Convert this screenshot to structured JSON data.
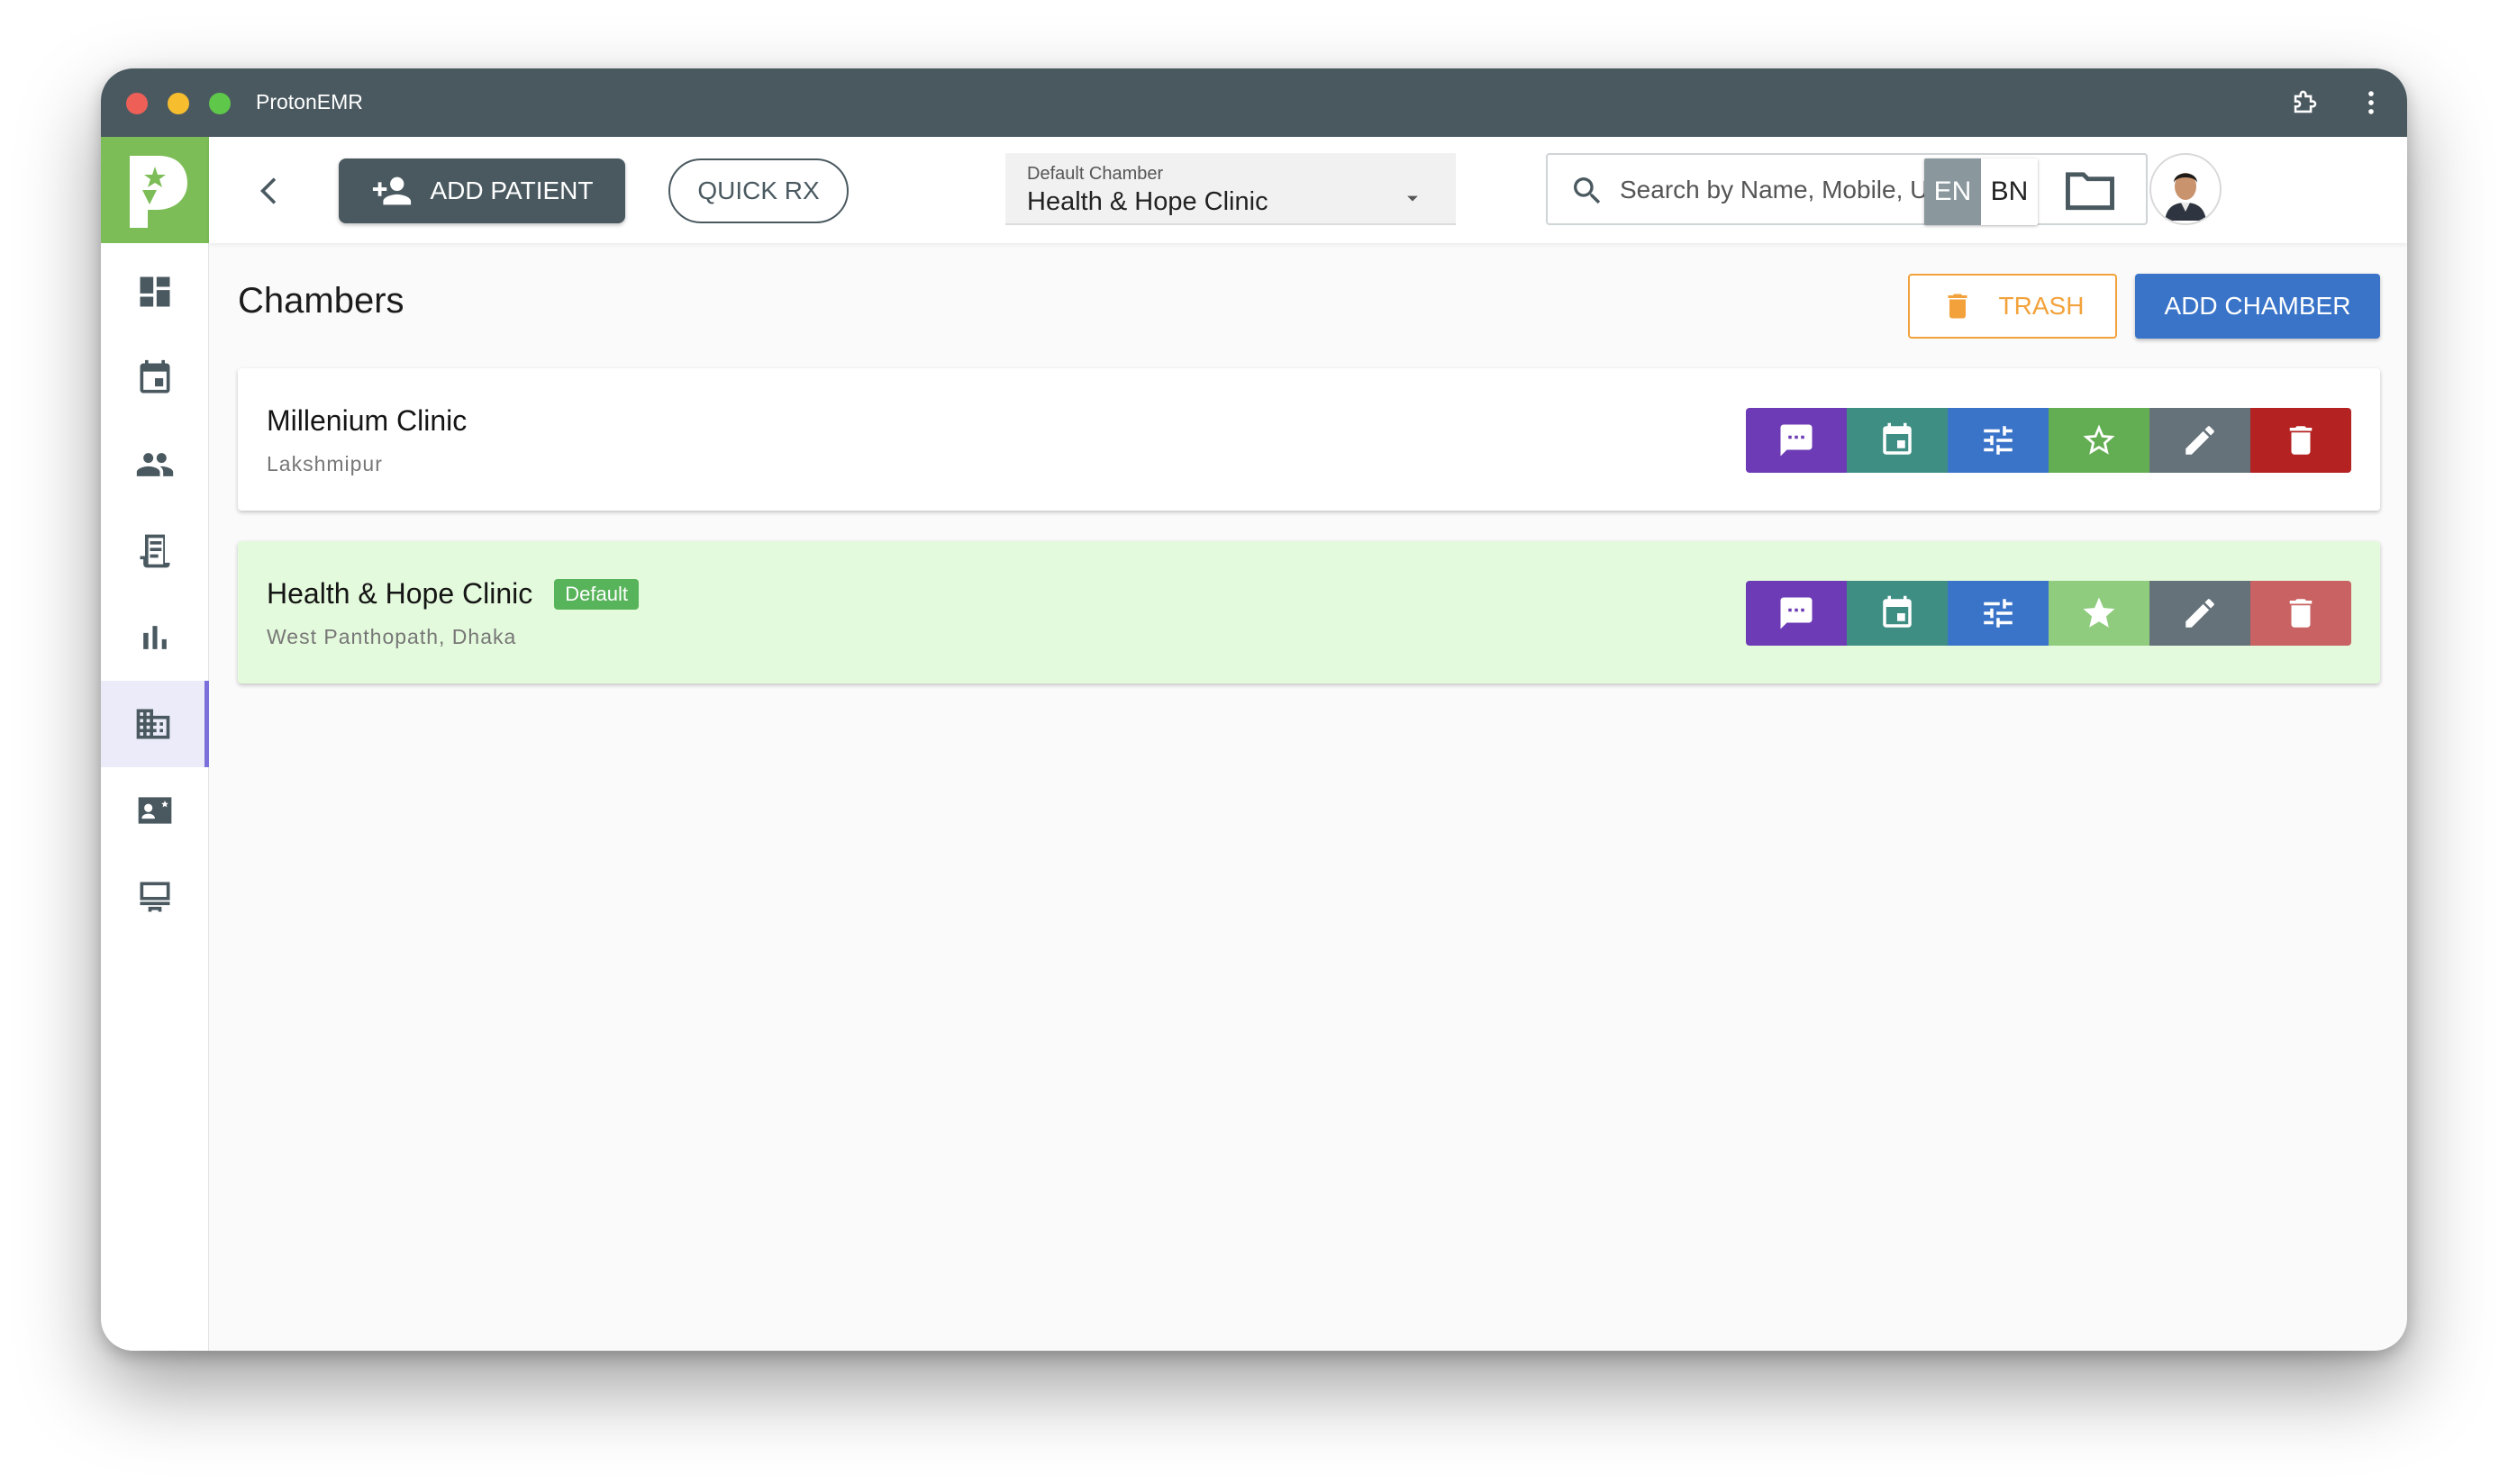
{
  "window": {
    "title": "ProtonEMR"
  },
  "header": {
    "add_patient_label": "ADD PATIENT",
    "quick_rx_label": "QUICK RX",
    "chamber_select": {
      "label": "Default Chamber",
      "value": "Health & Hope Clinic"
    },
    "search": {
      "placeholder": "Search by Name, Mobile, UUID..."
    },
    "lang": {
      "en": "EN",
      "bn": "BN",
      "active": "EN"
    }
  },
  "sidebar": {
    "items": [
      {
        "name": "dashboard",
        "icon": "dashboard-icon"
      },
      {
        "name": "appointments",
        "icon": "calendar-icon"
      },
      {
        "name": "patients",
        "icon": "people-icon"
      },
      {
        "name": "prescriptions",
        "icon": "receipt-icon"
      },
      {
        "name": "reports",
        "icon": "bar-chart-icon"
      },
      {
        "name": "chambers",
        "icon": "building-icon",
        "active": true
      },
      {
        "name": "contacts",
        "icon": "contact-card-icon"
      },
      {
        "name": "pos",
        "icon": "pos-terminal-icon"
      }
    ]
  },
  "main": {
    "title": "Chambers",
    "trash_label": "TRASH",
    "add_chamber_label": "ADD CHAMBER",
    "chambers": [
      {
        "name": "Millenium Clinic",
        "address": "Lakshmipur",
        "is_default": false
      },
      {
        "name": "Health & Hope Clinic",
        "address": "West Panthopath, Dhaka",
        "is_default": true,
        "badge": "Default"
      }
    ]
  },
  "colors": {
    "titlebar": "#4a5960",
    "brand_green": "#7cbd57",
    "primary_blue": "#3a74c9",
    "trash_orange": "#f3a23b",
    "default_card_bg": "#e4fadc",
    "action_message": "#6c3bb5",
    "action_calendar": "#3e8e83",
    "action_settings": "#3a74c9",
    "action_star": "#63ad52",
    "action_edit": "#65727a",
    "action_delete": "#b52222"
  }
}
